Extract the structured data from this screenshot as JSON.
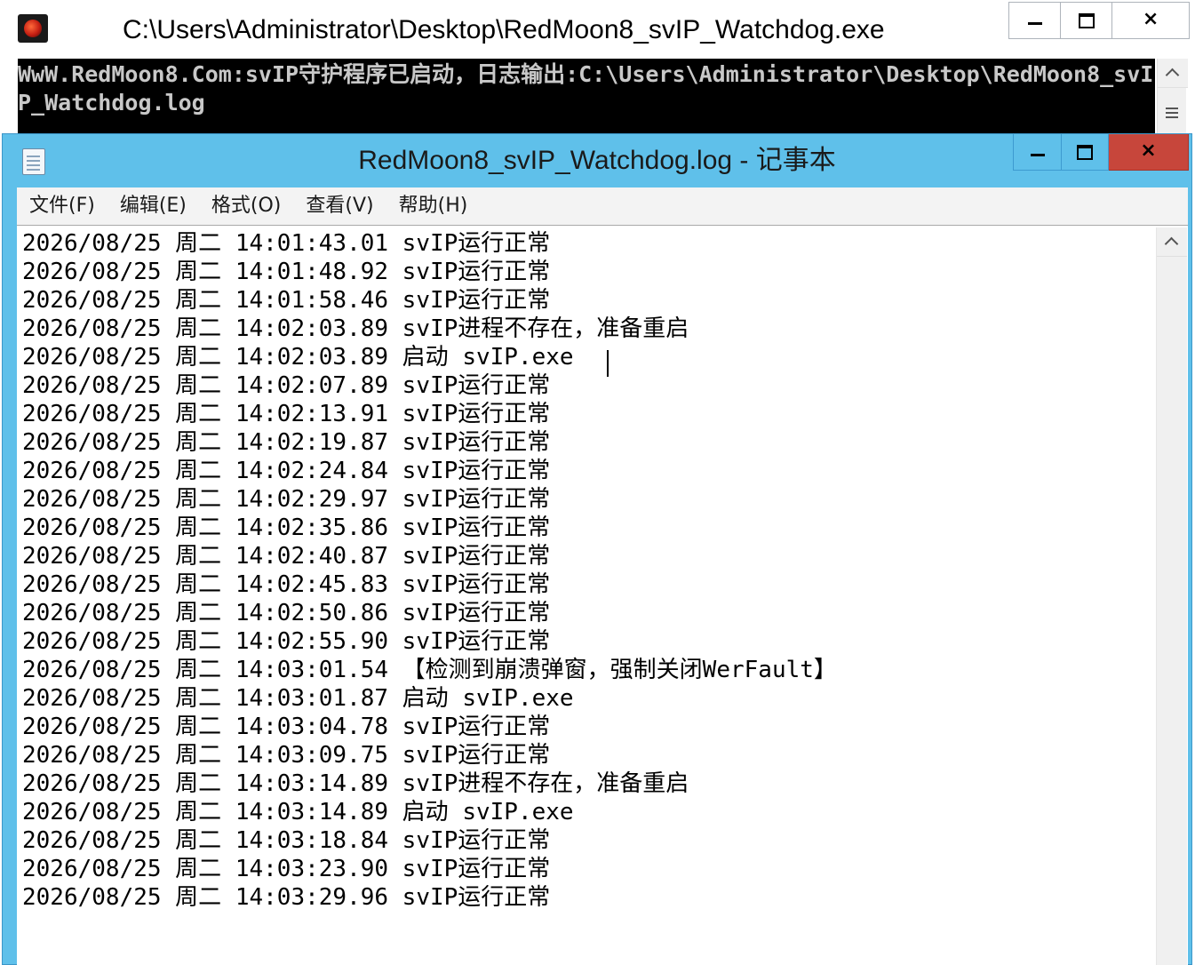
{
  "console": {
    "title": "C:\\Users\\Administrator\\Desktop\\RedMoon8_svIP_Watchdog.exe",
    "output": "WwW.RedMoon8.Com:svIP守护程序已启动，日志输出:C:\\Users\\Administrator\\Desktop\\RedMoon8_svIP_Watchdog.log",
    "icon": "redmoon-app-icon",
    "controls": {
      "minimize": "minimize-icon",
      "maximize": "maximize-icon",
      "close": "×"
    }
  },
  "notepad": {
    "title": "RedMoon8_svIP_Watchdog.log - 记事本",
    "icon": "notepad-icon",
    "controls": {
      "minimize": "minimize-icon",
      "maximize": "maximize-icon",
      "close": "×"
    },
    "close_color": "#c7463b",
    "accent": "#5fc0ea",
    "menu": [
      {
        "label": "文件(F)"
      },
      {
        "label": "编辑(E)"
      },
      {
        "label": "格式(O)"
      },
      {
        "label": "查看(V)"
      },
      {
        "label": "帮助(H)"
      }
    ],
    "log_lines": [
      "2026/08/25 周二 14:01:43.01 svIP运行正常",
      "2026/08/25 周二 14:01:48.92 svIP运行正常",
      "2026/08/25 周二 14:01:58.46 svIP运行正常",
      "2026/08/25 周二 14:02:03.89 svIP进程不存在，准备重启",
      "2026/08/25 周二 14:02:03.89 启动 svIP.exe",
      "2026/08/25 周二 14:02:07.89 svIP运行正常",
      "2026/08/25 周二 14:02:13.91 svIP运行正常",
      "2026/08/25 周二 14:02:19.87 svIP运行正常",
      "2026/08/25 周二 14:02:24.84 svIP运行正常",
      "2026/08/25 周二 14:02:29.97 svIP运行正常",
      "2026/08/25 周二 14:02:35.86 svIP运行正常",
      "2026/08/25 周二 14:02:40.87 svIP运行正常",
      "2026/08/25 周二 14:02:45.83 svIP运行正常",
      "2026/08/25 周二 14:02:50.86 svIP运行正常",
      "2026/08/25 周二 14:02:55.90 svIP运行正常",
      "2026/08/25 周二 14:03:01.54 【检测到崩溃弹窗，强制关闭WerFault】",
      "2026/08/25 周二 14:03:01.87 启动 svIP.exe",
      "2026/08/25 周二 14:03:04.78 svIP运行正常",
      "2026/08/25 周二 14:03:09.75 svIP运行正常",
      "2026/08/25 周二 14:03:14.89 svIP进程不存在，准备重启",
      "2026/08/25 周二 14:03:14.89 启动 svIP.exe",
      "2026/08/25 周二 14:03:18.84 svIP运行正常",
      "2026/08/25 周二 14:03:23.90 svIP运行正常",
      "2026/08/25 周二 14:03:29.96 svIP运行正常"
    ]
  }
}
